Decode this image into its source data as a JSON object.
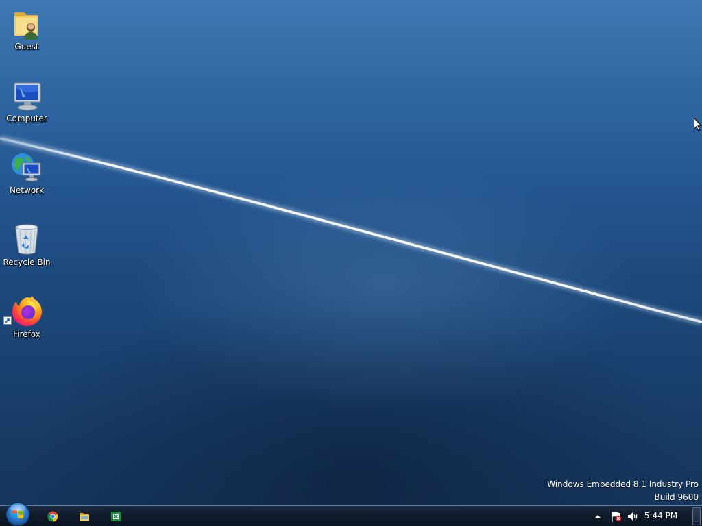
{
  "desktop": {
    "icons": [
      {
        "label": "Guest",
        "icon": "user-folder-icon"
      },
      {
        "label": "Computer",
        "icon": "computer-icon"
      },
      {
        "label": "Network",
        "icon": "network-icon"
      },
      {
        "label": "Recycle Bin",
        "icon": "recycle-bin-icon"
      },
      {
        "label": "Firefox",
        "icon": "firefox-icon"
      }
    ],
    "watermark": {
      "line1": "Windows Embedded 8.1 Industry Pro",
      "line2": "Build 9600"
    }
  },
  "taskbar": {
    "start": {
      "icon": "windows-start-orb-icon"
    },
    "pinned": [
      {
        "icon": "chrome-icon"
      },
      {
        "icon": "file-explorer-icon"
      },
      {
        "icon": "spreadsheet-app-icon"
      }
    ],
    "tray": {
      "icons": [
        "show-hidden-icons-chevron-icon",
        "action-center-flag-icon",
        "volume-icon"
      ],
      "clock": "5:44 PM"
    }
  },
  "colors": {
    "wallpaper_top": "#3f78b4",
    "wallpaper_bottom": "#15355b",
    "taskbar": "#0f1a29",
    "text": "#ffffff"
  }
}
